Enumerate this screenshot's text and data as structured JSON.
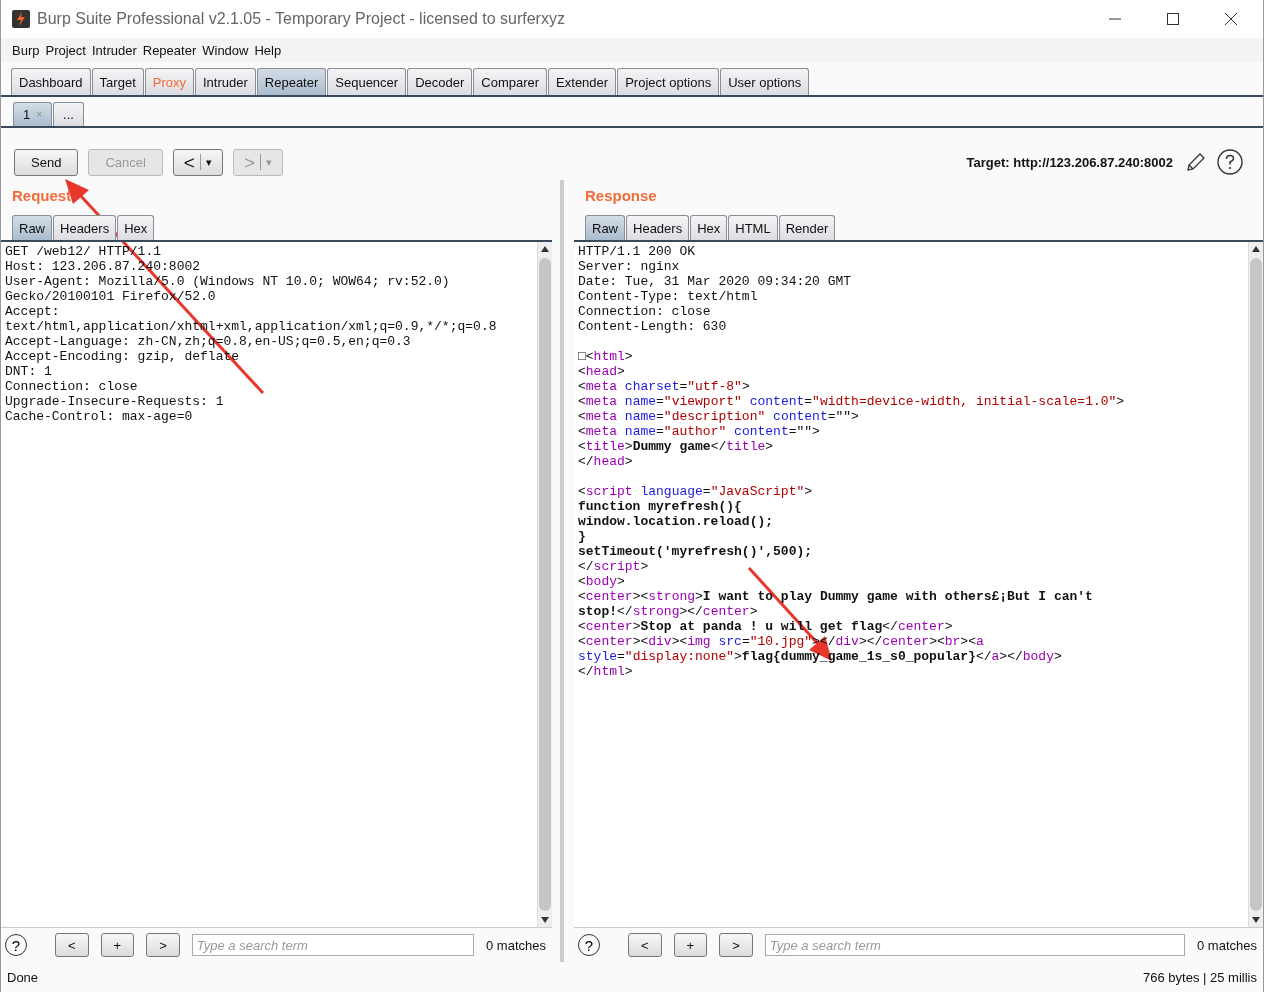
{
  "window": {
    "title": "Burp Suite Professional v2.1.05 - Temporary Project - licensed to surferxyz"
  },
  "menu": [
    "Burp",
    "Project",
    "Intruder",
    "Repeater",
    "Window",
    "Help"
  ],
  "tabs": [
    {
      "label": "Dashboard",
      "selected": false,
      "alert": false
    },
    {
      "label": "Target",
      "selected": false,
      "alert": false
    },
    {
      "label": "Proxy",
      "selected": false,
      "alert": true
    },
    {
      "label": "Intruder",
      "selected": false,
      "alert": false
    },
    {
      "label": "Repeater",
      "selected": true,
      "alert": false
    },
    {
      "label": "Sequencer",
      "selected": false,
      "alert": false
    },
    {
      "label": "Decoder",
      "selected": false,
      "alert": false
    },
    {
      "label": "Comparer",
      "selected": false,
      "alert": false
    },
    {
      "label": "Extender",
      "selected": false,
      "alert": false
    },
    {
      "label": "Project options",
      "selected": false,
      "alert": false
    },
    {
      "label": "User options",
      "selected": false,
      "alert": false
    }
  ],
  "repeater_tabs": [
    {
      "label": "1",
      "close": "×",
      "selected": true
    },
    {
      "label": "...",
      "selected": false
    }
  ],
  "toolbar": {
    "send": "Send",
    "cancel": "Cancel",
    "back": "<",
    "forward": ">",
    "dropdown": "▾",
    "target": "Target: http://123.206.87.240:8002"
  },
  "request": {
    "title": "Request",
    "tabs": [
      {
        "label": "Raw",
        "selected": true
      },
      {
        "label": "Headers",
        "selected": false
      },
      {
        "label": "Hex",
        "selected": false
      }
    ],
    "blocks": [
      [
        [
          {
            "kind": "plain",
            "text": "GET /web12/ HTTP/1.1"
          }
        ],
        [
          {
            "kind": "plain",
            "text": "Host: 123.206.87.240:8002"
          }
        ],
        [
          {
            "kind": "plain",
            "text": "User-Agent: Mozilla/5.0 (Windows NT 10.0; WOW64; rv:52.0)"
          }
        ],
        [
          {
            "kind": "plain",
            "text": "Gecko/20100101 Firefox/52.0"
          }
        ],
        [
          {
            "kind": "plain",
            "text": "Accept:"
          }
        ],
        [
          {
            "kind": "plain",
            "text": "text/html,application/xhtml+xml,application/xml;q=0.9,*/*;q=0.8"
          }
        ],
        [
          {
            "kind": "plain",
            "text": "Accept-Language: zh-CN,zh;q=0.8,en-US;q=0.5,en;q=0.3"
          }
        ],
        [
          {
            "kind": "plain",
            "text": "Accept-Encoding: gzip, deflate"
          }
        ],
        [
          {
            "kind": "plain",
            "text": "DNT: 1"
          }
        ],
        [
          {
            "kind": "plain",
            "text": "Connection: close"
          }
        ],
        [
          {
            "kind": "plain",
            "text": "Upgrade-Insecure-Requests: 1"
          }
        ],
        [
          {
            "kind": "plain",
            "text": "Cache-Control: max-age=0"
          }
        ]
      ]
    ],
    "search": {
      "help": "?",
      "prev": "<",
      "add": "+",
      "next": ">",
      "placeholder": "Type a search term",
      "matches": "0 matches"
    }
  },
  "response": {
    "title": "Response",
    "tabs": [
      {
        "label": "Raw",
        "selected": true
      },
      {
        "label": "Headers",
        "selected": false
      },
      {
        "label": "Hex",
        "selected": false
      },
      {
        "label": "HTML",
        "selected": false
      },
      {
        "label": "Render",
        "selected": false
      }
    ],
    "blocks": [
      [
        [
          {
            "kind": "plain",
            "text": "HTTP/1.1 200 OK"
          }
        ],
        [
          {
            "kind": "plain",
            "text": "Server: nginx"
          }
        ],
        [
          {
            "kind": "plain",
            "text": "Date: Tue, 31 Mar 2020 09:34:20 GMT"
          }
        ],
        [
          {
            "kind": "plain",
            "text": "Content-Type: text/html"
          }
        ],
        [
          {
            "kind": "plain",
            "text": "Connection: close"
          }
        ],
        [
          {
            "kind": "plain",
            "text": "Content-Length: 630"
          }
        ]
      ],
      [
        [
          {
            "kind": "plain",
            "text": "□<"
          },
          {
            "kind": "tag",
            "text": "html"
          },
          {
            "kind": "plain",
            "text": ">"
          }
        ],
        [
          {
            "kind": "plain",
            "text": "<"
          },
          {
            "kind": "tag",
            "text": "head"
          },
          {
            "kind": "plain",
            "text": ">"
          }
        ],
        [
          {
            "kind": "plain",
            "text": "<"
          },
          {
            "kind": "tag",
            "text": "meta"
          },
          {
            "kind": "attr",
            "text": " charset"
          },
          {
            "kind": "plain",
            "text": "="
          },
          {
            "kind": "value",
            "text": "\"utf-8\""
          },
          {
            "kind": "plain",
            "text": ">"
          }
        ],
        [
          {
            "kind": "plain",
            "text": "<"
          },
          {
            "kind": "tag",
            "text": "meta"
          },
          {
            "kind": "attr",
            "text": " name"
          },
          {
            "kind": "plain",
            "text": "="
          },
          {
            "kind": "value",
            "text": "\"viewport\""
          },
          {
            "kind": "attr",
            "text": " content"
          },
          {
            "kind": "plain",
            "text": "="
          },
          {
            "kind": "value",
            "text": "\"width=device-width, initial-scale=1.0\""
          },
          {
            "kind": "plain",
            "text": ">"
          }
        ],
        [
          {
            "kind": "plain",
            "text": "<"
          },
          {
            "kind": "tag",
            "text": "meta"
          },
          {
            "kind": "attr",
            "text": " name"
          },
          {
            "kind": "plain",
            "text": "="
          },
          {
            "kind": "value",
            "text": "\"description\""
          },
          {
            "kind": "attr",
            "text": " content"
          },
          {
            "kind": "plain",
            "text": "=\"\">"
          }
        ],
        [
          {
            "kind": "plain",
            "text": "<"
          },
          {
            "kind": "tag",
            "text": "meta"
          },
          {
            "kind": "attr",
            "text": " name"
          },
          {
            "kind": "plain",
            "text": "="
          },
          {
            "kind": "value",
            "text": "\"author\""
          },
          {
            "kind": "attr",
            "text": " content"
          },
          {
            "kind": "plain",
            "text": "=\"\">"
          }
        ],
        [
          {
            "kind": "plain",
            "text": "<"
          },
          {
            "kind": "tag",
            "text": "title"
          },
          {
            "kind": "plain",
            "text": ">"
          },
          {
            "kind": "bold",
            "text": "Dummy game"
          },
          {
            "kind": "plain",
            "text": "</"
          },
          {
            "kind": "tag",
            "text": "title"
          },
          {
            "kind": "plain",
            "text": ">"
          }
        ],
        [
          {
            "kind": "plain",
            "text": "</"
          },
          {
            "kind": "tag",
            "text": "head"
          },
          {
            "kind": "plain",
            "text": ">"
          }
        ]
      ],
      [
        [
          {
            "kind": "plain",
            "text": "<"
          },
          {
            "kind": "tag",
            "text": "script"
          },
          {
            "kind": "attr",
            "text": " language"
          },
          {
            "kind": "plain",
            "text": "="
          },
          {
            "kind": "value",
            "text": "\"JavaScript\""
          },
          {
            "kind": "plain",
            "text": ">"
          }
        ],
        [
          {
            "kind": "bold",
            "text": "function myrefresh(){"
          }
        ],
        [
          {
            "kind": "bold",
            "text": "window.location.reload();"
          }
        ],
        [
          {
            "kind": "bold",
            "text": "}"
          }
        ],
        [
          {
            "kind": "bold",
            "text": "setTimeout('myrefresh()',500);"
          }
        ],
        [
          {
            "kind": "plain",
            "text": "</"
          },
          {
            "kind": "tag",
            "text": "script"
          },
          {
            "kind": "plain",
            "text": ">"
          }
        ],
        [
          {
            "kind": "plain",
            "text": "<"
          },
          {
            "kind": "tag",
            "text": "body"
          },
          {
            "kind": "plain",
            "text": ">"
          }
        ],
        [
          {
            "kind": "plain",
            "text": "<"
          },
          {
            "kind": "tag",
            "text": "center"
          },
          {
            "kind": "plain",
            "text": "><"
          },
          {
            "kind": "tag",
            "text": "strong"
          },
          {
            "kind": "plain",
            "text": ">"
          },
          {
            "kind": "bold",
            "text": "I want to play Dummy game with others£¡But I can't"
          }
        ],
        [
          {
            "kind": "bold",
            "text": "stop!"
          },
          {
            "kind": "plain",
            "text": "</"
          },
          {
            "kind": "tag",
            "text": "strong"
          },
          {
            "kind": "plain",
            "text": "></"
          },
          {
            "kind": "tag",
            "text": "center"
          },
          {
            "kind": "plain",
            "text": ">"
          }
        ],
        [
          {
            "kind": "plain",
            "text": "<"
          },
          {
            "kind": "tag",
            "text": "center"
          },
          {
            "kind": "plain",
            "text": ">"
          },
          {
            "kind": "bold",
            "text": "Stop at panda ! u will get flag"
          },
          {
            "kind": "plain",
            "text": "</"
          },
          {
            "kind": "tag",
            "text": "center"
          },
          {
            "kind": "plain",
            "text": ">"
          }
        ],
        [
          {
            "kind": "plain",
            "text": "<"
          },
          {
            "kind": "tag",
            "text": "center"
          },
          {
            "kind": "plain",
            "text": "><"
          },
          {
            "kind": "tag",
            "text": "div"
          },
          {
            "kind": "plain",
            "text": "><"
          },
          {
            "kind": "tag",
            "text": "img"
          },
          {
            "kind": "attr",
            "text": " src"
          },
          {
            "kind": "plain",
            "text": "="
          },
          {
            "kind": "value",
            "text": "\"10.jpg\""
          },
          {
            "kind": "plain",
            "text": "></"
          },
          {
            "kind": "tag",
            "text": "div"
          },
          {
            "kind": "plain",
            "text": "></"
          },
          {
            "kind": "tag",
            "text": "center"
          },
          {
            "kind": "plain",
            "text": "><"
          },
          {
            "kind": "tag",
            "text": "br"
          },
          {
            "kind": "plain",
            "text": "><"
          },
          {
            "kind": "tag",
            "text": "a"
          }
        ],
        [
          {
            "kind": "attr",
            "text": "style"
          },
          {
            "kind": "plain",
            "text": "="
          },
          {
            "kind": "value",
            "text": "\"display:none\""
          },
          {
            "kind": "plain",
            "text": ">"
          },
          {
            "kind": "bold",
            "text": "flag{dummy_game_1s_s0_popular}"
          },
          {
            "kind": "plain",
            "text": "</"
          },
          {
            "kind": "tag",
            "text": "a"
          },
          {
            "kind": "plain",
            "text": "></"
          },
          {
            "kind": "tag",
            "text": "body"
          },
          {
            "kind": "plain",
            "text": ">"
          }
        ],
        [
          {
            "kind": "plain",
            "text": "</"
          },
          {
            "kind": "tag",
            "text": "html"
          },
          {
            "kind": "plain",
            "text": ">"
          }
        ]
      ]
    ],
    "search": {
      "help": "?",
      "prev": "<",
      "add": "+",
      "next": ">",
      "placeholder": "Type a search term",
      "matches": "0 matches"
    }
  },
  "status_bar": {
    "left": "Done",
    "right": "766 bytes | 25 millis"
  }
}
